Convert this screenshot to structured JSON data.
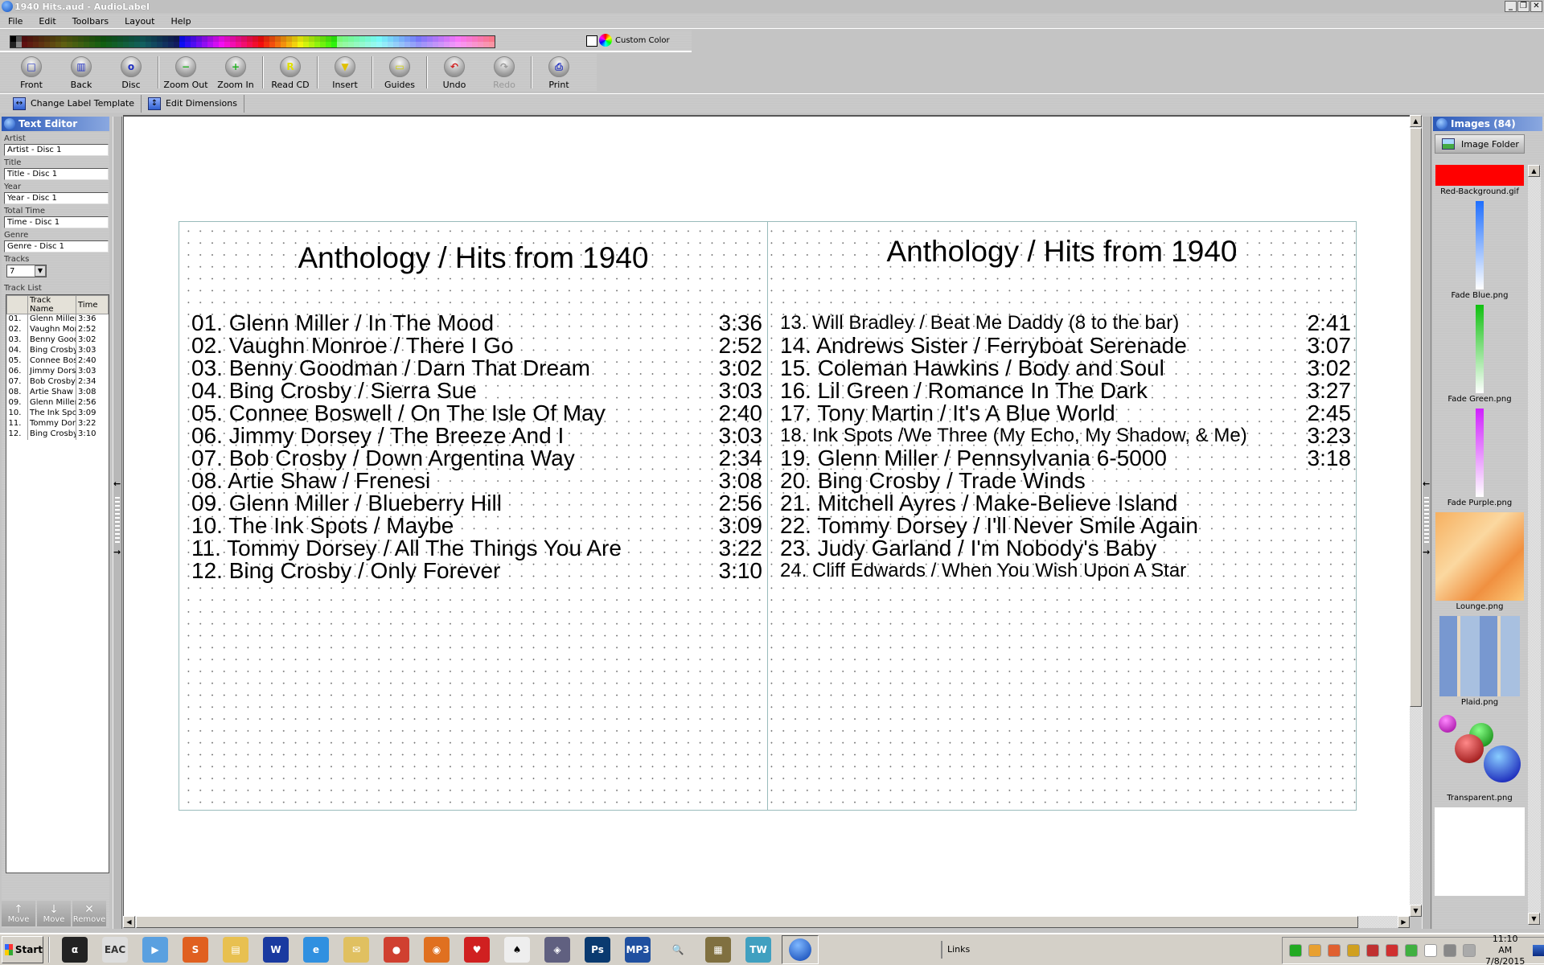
{
  "window": {
    "title": "1940 Hits.aud - AudioLabel",
    "controls": [
      "minimize",
      "restore",
      "close"
    ]
  },
  "menu": [
    "File",
    "Edit",
    "Toolbars",
    "Layout",
    "Help"
  ],
  "palette": {
    "custom_color_label": "Custom Color"
  },
  "toolbar": [
    {
      "label": "Front",
      "icon": "front-icon",
      "glyph": "□",
      "color": "#2030c0"
    },
    {
      "label": "Back",
      "icon": "back-icon",
      "glyph": "▥",
      "color": "#2030c0"
    },
    {
      "label": "Disc",
      "icon": "disc-icon",
      "glyph": "o",
      "color": "#2030c0"
    },
    {
      "sep": true
    },
    {
      "label": "Zoom Out",
      "icon": "zoom-out-icon",
      "glyph": "−",
      "color": "#20b020"
    },
    {
      "label": "Zoom In",
      "icon": "zoom-in-icon",
      "glyph": "+",
      "color": "#20b020"
    },
    {
      "sep": true
    },
    {
      "label": "Read CD",
      "icon": "read-cd-icon",
      "glyph": "R",
      "color": "#e0e000"
    },
    {
      "sep": true
    },
    {
      "label": "Insert",
      "icon": "insert-icon",
      "glyph": "▼",
      "color": "#e0c000"
    },
    {
      "sep": true
    },
    {
      "label": "Guides",
      "icon": "guides-icon",
      "glyph": "▭",
      "color": "#d0d000"
    },
    {
      "sep": true
    },
    {
      "label": "Undo",
      "icon": "undo-icon",
      "glyph": "↶",
      "color": "#d02020"
    },
    {
      "label": "Redo",
      "icon": "redo-icon",
      "glyph": "↷",
      "color": "#999999",
      "disabled": true
    },
    {
      "sep": true
    },
    {
      "label": "Print",
      "icon": "print-icon",
      "glyph": "⎙",
      "color": "#2030c0"
    }
  ],
  "subtoolbar": {
    "change_template": "Change Label Template",
    "edit_dimensions": "Edit Dimensions"
  },
  "text_editor": {
    "title": "Text Editor",
    "fields": [
      {
        "label": "Artist",
        "value": "Artist - Disc 1"
      },
      {
        "label": "Title",
        "value": "Title - Disc 1"
      },
      {
        "label": "Year",
        "value": "Year - Disc 1"
      },
      {
        "label": "Total Time",
        "value": "Time - Disc 1"
      },
      {
        "label": "Genre",
        "value": "Genre - Disc 1"
      }
    ],
    "tracks_label": "Tracks",
    "tracks_value": "7",
    "track_list_label": "Track List",
    "columns": [
      "",
      "Track Name",
      "Time"
    ],
    "rows": [
      [
        "01.",
        "Glenn Miller ,",
        "3:36"
      ],
      [
        "02.",
        "Vaughn Mon",
        "2:52"
      ],
      [
        "03.",
        "Benny Good",
        "3:02"
      ],
      [
        "04.",
        "Bing Crosby",
        "3:03"
      ],
      [
        "05.",
        "Connee Bos",
        "2:40"
      ],
      [
        "06.",
        "Jimmy Dorse",
        "3:03"
      ],
      [
        "07.",
        "Bob Crosby",
        "2:34"
      ],
      [
        "08.",
        "Artie Shaw /",
        "3:08"
      ],
      [
        "09.",
        "Glenn Miller ,",
        "2:56"
      ],
      [
        "10.",
        "The Ink Spo",
        "3:09"
      ],
      [
        "11.",
        "Tommy Dors",
        "3:22"
      ],
      [
        "12.",
        "Bing Crosby",
        "3:10"
      ]
    ],
    "buttons": [
      {
        "label": "Move",
        "glyph": "↑"
      },
      {
        "label": "Move",
        "glyph": "↓"
      },
      {
        "label": "Remove",
        "glyph": "✕"
      }
    ]
  },
  "label": {
    "left": {
      "title": "Anthology / Hits from 1940",
      "tracks": [
        {
          "name": "01. Glenn Miller / In The Mood",
          "time": "3:36"
        },
        {
          "name": "02. Vaughn Monroe / There I Go",
          "time": "2:52"
        },
        {
          "name": "03. Benny Goodman / Darn That Dream",
          "time": "3:02"
        },
        {
          "name": "04. Bing Crosby / Sierra Sue",
          "time": "3:03"
        },
        {
          "name": "05. Connee Boswell / On The Isle Of May",
          "time": "2:40"
        },
        {
          "name": "06. Jimmy Dorsey / The Breeze And I",
          "time": "3:03"
        },
        {
          "name": "07. Bob Crosby / Down Argentina Way",
          "time": "2:34"
        },
        {
          "name": "08. Artie Shaw / Frenesi",
          "time": "3:08"
        },
        {
          "name": "09. Glenn Miller / Blueberry Hill",
          "time": "2:56"
        },
        {
          "name": "10. The Ink Spots / Maybe",
          "time": "3:09"
        },
        {
          "name": "11. Tommy Dorsey / All The Things You Are",
          "time": "3:22"
        },
        {
          "name": "12. Bing Crosby / Only Forever",
          "time": "3:10"
        }
      ]
    },
    "right": {
      "title": "Anthology / Hits from 1940",
      "tracks": [
        {
          "name": "13. Will Bradley / Beat Me Daddy (8 to the bar)",
          "time": "2:41"
        },
        {
          "name": "14. Andrews Sister / Ferryboat Serenade",
          "time": "3:07"
        },
        {
          "name": "15. Coleman Hawkins / Body and Soul",
          "time": "3:02"
        },
        {
          "name": "16. Lil Green / Romance In The Dark",
          "time": "3:27"
        },
        {
          "name": "17. Tony Martin / It's A Blue World",
          "time": "2:45"
        },
        {
          "name": "18. Ink Spots /We Three (My Echo, My Shadow, & Me)",
          "time": "3:23"
        },
        {
          "name": "19. Glenn Miller / Pennsylvania 6-5000",
          "time": "3:18"
        },
        {
          "name": "20. Bing Crosby / Trade Winds",
          "time": ""
        },
        {
          "name": "21. Mitchell Ayres / Make-Believe Island",
          "time": ""
        },
        {
          "name": "22. Tommy Dorsey / I'll Never Smile Again",
          "time": ""
        },
        {
          "name": "23. Judy Garland / I'm Nobody's Baby",
          "time": ""
        },
        {
          "name": "24. Cliff Edwards / When You Wish Upon A Star",
          "time": ""
        }
      ]
    }
  },
  "images_panel": {
    "title": "Images (84)",
    "folder_button": "Image Folder",
    "items": [
      {
        "name": "Red-Background.gif"
      },
      {
        "name": "Fade Blue.png"
      },
      {
        "name": "Fade Green.png"
      },
      {
        "name": "Fade Purple.png"
      },
      {
        "name": "Lounge.png"
      },
      {
        "name": "Plaid.png"
      },
      {
        "name": "Transparent.png"
      }
    ]
  },
  "taskbar": {
    "start": "Start",
    "apps": [
      {
        "icon": "alpha-icon",
        "glyph": "α",
        "bg": "#222"
      },
      {
        "icon": "eac-icon",
        "glyph": "EAC",
        "bg": "#ddd",
        "fg": "#333"
      },
      {
        "icon": "media-player-icon",
        "glyph": "▶",
        "bg": "#5aa0e0"
      },
      {
        "icon": "s-app-icon",
        "glyph": "S",
        "bg": "#e06020"
      },
      {
        "icon": "file-explorer-icon",
        "glyph": "▤",
        "bg": "#e8c050"
      },
      {
        "icon": "word-icon",
        "glyph": "W",
        "bg": "#1a3aa0"
      },
      {
        "icon": "internet-explorer-icon",
        "glyph": "e",
        "bg": "#3090e0"
      },
      {
        "icon": "mail-icon",
        "glyph": "✉",
        "bg": "#e0c060"
      },
      {
        "icon": "chrome-icon",
        "glyph": "●",
        "bg": "#d04030"
      },
      {
        "icon": "firefox-icon",
        "glyph": "◉",
        "bg": "#e07020"
      },
      {
        "icon": "hearts-icon",
        "glyph": "♥",
        "bg": "#d02020"
      },
      {
        "icon": "solitaire-icon",
        "glyph": "♠",
        "bg": "#eee",
        "fg": "#000"
      },
      {
        "icon": "speaker-app-icon",
        "glyph": "◈",
        "bg": "#606080"
      },
      {
        "icon": "photoshop-icon",
        "glyph": "Ps",
        "bg": "#0a3a70"
      },
      {
        "icon": "mp3-wav-icon",
        "glyph": "MP3",
        "bg": "#2050a0"
      },
      {
        "icon": "search-lite-icon",
        "glyph": "🔍",
        "bg": "#d4d0c8",
        "fg": "#333"
      },
      {
        "icon": "winrar-icon",
        "glyph": "▦",
        "bg": "#807040"
      },
      {
        "icon": "treewin-icon",
        "glyph": "TW",
        "bg": "#40a0c0"
      }
    ],
    "links": "Links",
    "clock_time": "11:10 AM",
    "clock_date": "7/8/2015",
    "tray": [
      {
        "icon": "usb-check-icon",
        "color": "#2a2"
      },
      {
        "icon": "palette-tray-icon",
        "color": "#e8a030"
      },
      {
        "icon": "volume-tray-icon",
        "color": "#e06030"
      },
      {
        "icon": "checkmark-tray-icon",
        "color": "#d0a020"
      },
      {
        "icon": "house-x-icon",
        "color": "#c03030"
      },
      {
        "icon": "fox-icon",
        "color": "#d03030"
      },
      {
        "icon": "drive-check-icon",
        "color": "#40b040"
      },
      {
        "icon": "flag-icon",
        "color": "#ffffff"
      },
      {
        "icon": "network-icon",
        "color": "#888888"
      },
      {
        "icon": "speaker-icon",
        "color": "#aaaaaa"
      }
    ]
  }
}
